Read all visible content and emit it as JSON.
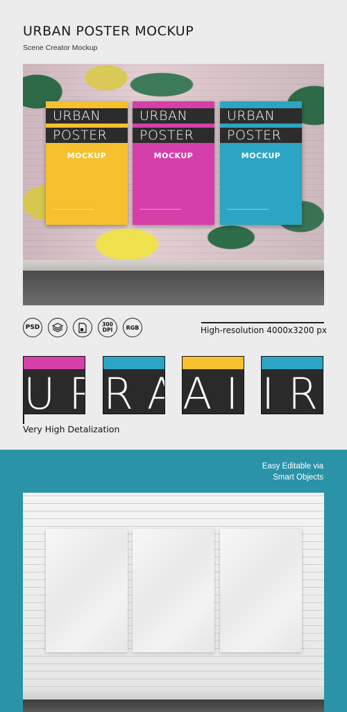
{
  "header": {
    "title": "URBAN POSTER MOCKUP",
    "subtitle": "Scene Creator Mockup"
  },
  "posters": [
    {
      "line1": "URBAN",
      "line2": "POSTER",
      "sub": "MOCKUP",
      "color": "#f6c02e"
    },
    {
      "line1": "URBAN",
      "line2": "POSTER",
      "sub": "MOCKUP",
      "color": "#d53fa9"
    },
    {
      "line1": "URBAN",
      "line2": "POSTER",
      "sub": "MOCKUP",
      "color": "#2ba5c3"
    }
  ],
  "features": {
    "icons": [
      {
        "name": "psd-icon",
        "label": "PSD"
      },
      {
        "name": "layers-icon",
        "label": ""
      },
      {
        "name": "smart-object-file-icon",
        "label": ""
      },
      {
        "name": "300-dpi-icon",
        "label": "300\nDPI"
      },
      {
        "name": "rgb-icon",
        "label": "RGB"
      }
    ],
    "resolution": "High-resolution 4000x3200 px"
  },
  "details": {
    "label": "Very High Detalization",
    "thumbs": [
      {
        "strip_color": "#d53fa9",
        "glyph": "U R"
      },
      {
        "strip_color": "#2ba5c3",
        "glyph": "R A"
      },
      {
        "strip_color": "#f6c02e",
        "glyph": "A I"
      },
      {
        "strip_color": "#2ba5c3",
        "glyph": "I R"
      }
    ]
  },
  "editable": {
    "line1": "Easy Editable via",
    "line2": "Smart Objects"
  },
  "colors": {
    "accent": "#2a93a8",
    "background": "#ececec"
  }
}
